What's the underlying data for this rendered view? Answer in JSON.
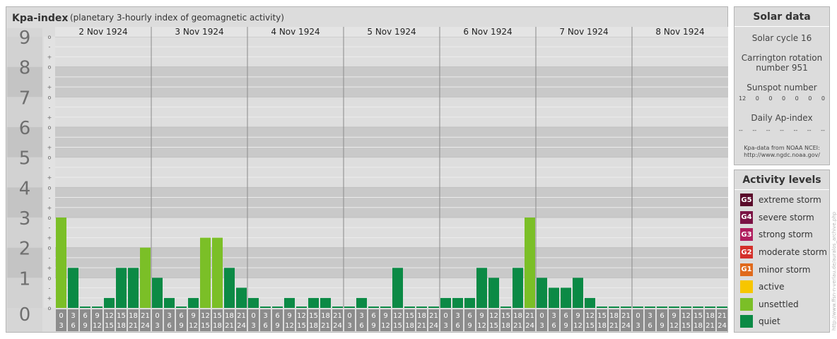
{
  "chart_data": {
    "type": "bar",
    "title": "Kpa-index",
    "subtitle": "(planetary 3-hourly index of geomagnetic activity)",
    "ylim": [
      0,
      9
    ],
    "y_ticks": [
      "0",
      "1",
      "2",
      "3",
      "4",
      "5",
      "6",
      "7",
      "8",
      "9"
    ],
    "sub_ticks": [
      "o",
      "+",
      "-"
    ],
    "days": [
      "2 Nov 1924",
      "3 Nov 1924",
      "4 Nov 1924",
      "5 Nov 1924",
      "6 Nov 1924",
      "7 Nov 1924",
      "8 Nov 1924"
    ],
    "interval_start_labels": [
      "0",
      "3",
      "6",
      "9",
      "12",
      "15",
      "18",
      "21"
    ],
    "interval_end_labels": [
      "3",
      "6",
      "9",
      "12",
      "15",
      "18",
      "21",
      "24"
    ],
    "series": [
      {
        "values": [
          3.0,
          1.33,
          0.0,
          0.0,
          0.33,
          1.33,
          1.33,
          2.0,
          1.0,
          0.33,
          0.0,
          0.33,
          2.33,
          2.33,
          1.33,
          0.67,
          0.33,
          0.0,
          0.0,
          0.33,
          0.0,
          0.33,
          0.33,
          0.0,
          0.0,
          0.33,
          0.0,
          0.0,
          1.33,
          0.0,
          0.0,
          0.0,
          0.33,
          0.33,
          0.33,
          1.33,
          1.0,
          0.0,
          1.33,
          3.0,
          1.0,
          0.67,
          0.67,
          1.0,
          0.33,
          0.0,
          0.0,
          0.0,
          0.0,
          0.0,
          0.0,
          0.0,
          0.0,
          0.0,
          0.0,
          0.0
        ]
      }
    ],
    "colors": {
      "quiet": "#0b8a45",
      "unsettled": "#7bbf27",
      "active": "#f7c600",
      "band_dark": "#c9c9c9",
      "band_light": "#dedede",
      "panel": "#dcdcdc",
      "axis_number": "#6f6f6f"
    }
  },
  "solar": {
    "title": "Solar data",
    "cycle": "Solar cycle 16",
    "carrington_line1": "Carrington rotation",
    "carrington_line2": "number 951",
    "sunspot_label": "Sunspot number",
    "sunspot_values": [
      "12",
      "0",
      "0",
      "0",
      "0",
      "0",
      "0"
    ],
    "ap_label": "Daily Ap-index",
    "ap_values": [
      "--",
      "--",
      "--",
      "--",
      "--",
      "--",
      "--"
    ],
    "source_line1": "Kpa-data from NOAA NCEI:",
    "source_line2": "http://www.ngdc.noaa.gov/"
  },
  "activity": {
    "title": "Activity levels",
    "levels": [
      {
        "badge": "G5",
        "label": "extreme storm",
        "color": "#5a0a2a"
      },
      {
        "badge": "G4",
        "label": "severe storm",
        "color": "#7a1244"
      },
      {
        "badge": "G3",
        "label": "strong storm",
        "color": "#b01e5e"
      },
      {
        "badge": "G2",
        "label": "moderate storm",
        "color": "#d4302a"
      },
      {
        "badge": "G1",
        "label": "minor storm",
        "color": "#e06a1c"
      },
      {
        "badge": "",
        "label": "active",
        "color": "#f7c600"
      },
      {
        "badge": "",
        "label": "unsettled",
        "color": "#7bbf27"
      },
      {
        "badge": "",
        "label": "quiet",
        "color": "#0b8a45"
      }
    ]
  },
  "credit": "http://www.ffsn-n-verlau.de/auralos_archive.php"
}
